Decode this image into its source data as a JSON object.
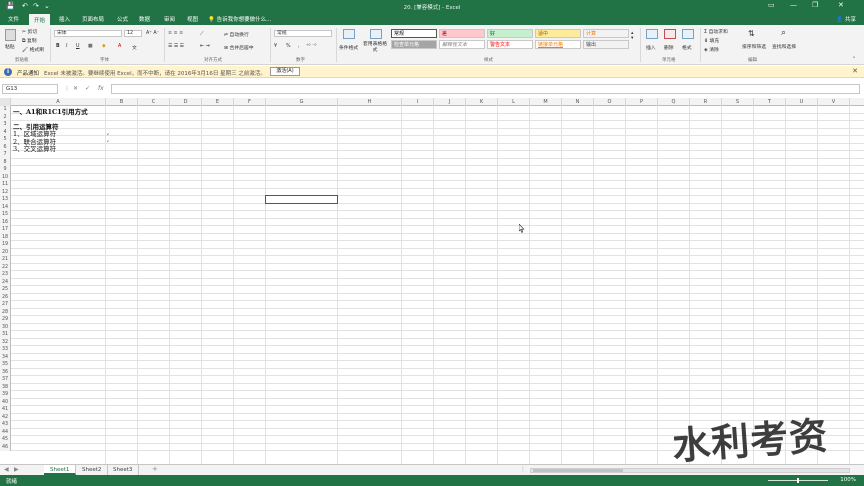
{
  "titlebar": {
    "title": "20. [兼容模式] - Excel",
    "save_glyph": "💾",
    "undo_glyph": "↶",
    "redo_glyph": "↷",
    "more_glyph": "⌄",
    "options_glyph": "▭",
    "minimize_glyph": "—",
    "restore_glyph": "❐",
    "close_glyph": "✕"
  },
  "tabs": [
    "文件",
    "开始",
    "插入",
    "页面布局",
    "公式",
    "数据",
    "审阅",
    "视图"
  ],
  "active_tab_index": 1,
  "tellme": "告诉我你想要做什么...",
  "share": "共享",
  "ribbon": {
    "clipboard": {
      "paste": "粘贴",
      "cut": "剪切",
      "copy": "复制",
      "format_painter": "格式刷",
      "label": "剪贴板"
    },
    "font": {
      "name": "宋体",
      "size": "12",
      "bold": "B",
      "italic": "I",
      "underline": "U",
      "label": "字体"
    },
    "alignment": {
      "wrap": "自动换行",
      "merge": "合并后居中",
      "label": "对齐方式"
    },
    "number": {
      "format": "常规",
      "percent": "%",
      "comma": ",",
      "label": "数字"
    },
    "styles": {
      "conditional": "条件格式",
      "table": "套用表格格式",
      "cells": [
        {
          "text": "常规",
          "bg": "#ffffff",
          "fg": "#000000"
        },
        {
          "text": "差",
          "bg": "#ffc7ce",
          "fg": "#9c0006"
        },
        {
          "text": "好",
          "bg": "#c6efce",
          "fg": "#006100"
        },
        {
          "text": "适中",
          "bg": "#ffeb9c",
          "fg": "#9c5700"
        },
        {
          "text": "计算",
          "bg": "#f2f2f2",
          "fg": "#fa7d00"
        },
        {
          "text": "检查单元格",
          "bg": "#a5a5a5",
          "fg": "#ffffff"
        },
        {
          "text": "解释性文本",
          "bg": "#ffffff",
          "fg": "#7f7f7f"
        },
        {
          "text": "警告文本",
          "bg": "#ffffff",
          "fg": "#ff0000"
        },
        {
          "text": "链接单元格",
          "bg": "#ffffff",
          "fg": "#fa7d00"
        },
        {
          "text": "输出",
          "bg": "#f2f2f2",
          "fg": "#3f3f3f"
        }
      ],
      "label": "样式"
    },
    "cells": {
      "insert": "插入",
      "delete": "删除",
      "format": "格式",
      "label": "单元格"
    },
    "editing": {
      "autosum": "自动求和",
      "fill": "填充",
      "clear": "清除",
      "sort": "排序和筛选",
      "find": "查找和选择",
      "label": "编辑"
    }
  },
  "message_bar": {
    "title": "产品通知",
    "text": "Excel 未被激活。要继续使用 Excel，而不中断，请在 2016年3月16日 星期三 之前激活。",
    "button": "激活(A)",
    "close": "✕"
  },
  "formula_bar": {
    "name_box": "G13",
    "cancel": "✕",
    "enter": "✓",
    "fx": "fx",
    "value": ""
  },
  "columns": [
    "A",
    "B",
    "C",
    "D",
    "E",
    "F",
    "G",
    "H",
    "I",
    "J",
    "K",
    "L",
    "M",
    "N",
    "O",
    "P",
    "Q",
    "R",
    "S",
    "T",
    "U",
    "V"
  ],
  "rows": [
    "1",
    "2",
    "3",
    "4",
    "5",
    "6",
    "7",
    "8",
    "9",
    "10",
    "11",
    "12",
    "13",
    "14",
    "15",
    "16",
    "17",
    "18",
    "19",
    "20",
    "21",
    "22",
    "23",
    "24",
    "25",
    "26",
    "27",
    "28",
    "29",
    "30",
    "31",
    "32",
    "33",
    "34",
    "35",
    "36",
    "37",
    "38",
    "39",
    "40",
    "41",
    "42",
    "43",
    "44",
    "45",
    "46"
  ],
  "cells": [
    {
      "row": 1,
      "text": "一、A1和R1C1引用方式",
      "bold": true
    },
    {
      "row": 3,
      "text": "二、引用运算符",
      "bold": true
    },
    {
      "row": 4,
      "text": "1、区域运算符",
      "bold": false,
      "b": ","
    },
    {
      "row": 5,
      "text": "2、联合运算符",
      "bold": false,
      "b": ","
    },
    {
      "row": 6,
      "text": "3、交叉运算符",
      "bold": false,
      "b": ""
    }
  ],
  "selected_cell": "G13",
  "sheet_tabs": [
    "Sheet1",
    "Sheet2",
    "Sheet3"
  ],
  "active_sheet_index": 0,
  "add_sheet": "+",
  "status": {
    "ready": "就绪",
    "zoom": "100%"
  },
  "watermark": "水利考资"
}
